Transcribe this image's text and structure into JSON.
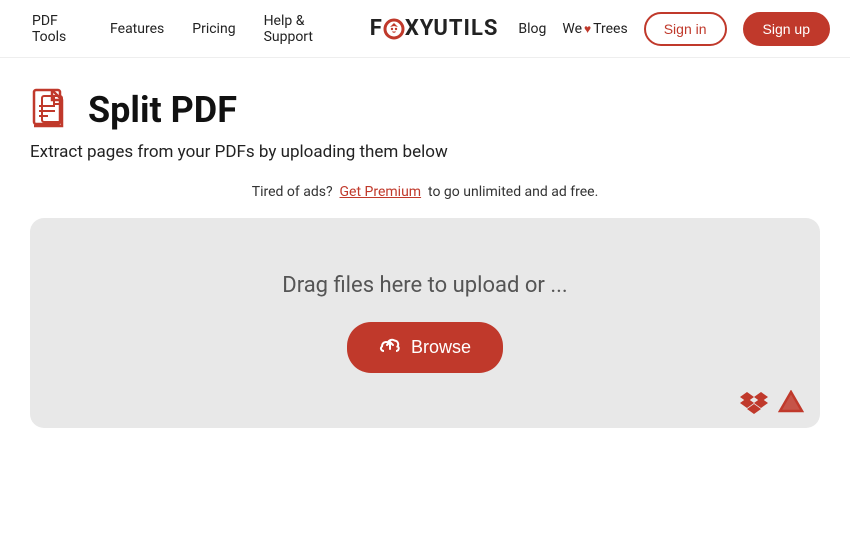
{
  "nav": {
    "links": [
      {
        "label": "PDF Tools",
        "id": "pdf-tools"
      },
      {
        "label": "Features",
        "id": "features"
      },
      {
        "label": "Pricing",
        "id": "pricing"
      },
      {
        "label": "Help & Support",
        "id": "help-support"
      }
    ],
    "logo": {
      "text_before": "F",
      "text_ring": "O",
      "text_after": "XYUTILS"
    },
    "logo_full": "FŌXYUTILS",
    "right_links": [
      {
        "label": "Blog",
        "id": "blog"
      },
      {
        "label": "We",
        "heart": "♥",
        "trees": "Trees",
        "id": "we-trees"
      }
    ],
    "signin_label": "Sign in",
    "signup_label": "Sign up"
  },
  "page": {
    "title": "Split PDF",
    "subtitle": "Extract pages from your PDFs by uploading them below",
    "promo_before": "Tired of ads?",
    "promo_link": "Get Premium",
    "promo_after": "to go unlimited and ad free."
  },
  "dropzone": {
    "drop_text": "Drag files here to upload or ...",
    "browse_label": "Browse"
  }
}
